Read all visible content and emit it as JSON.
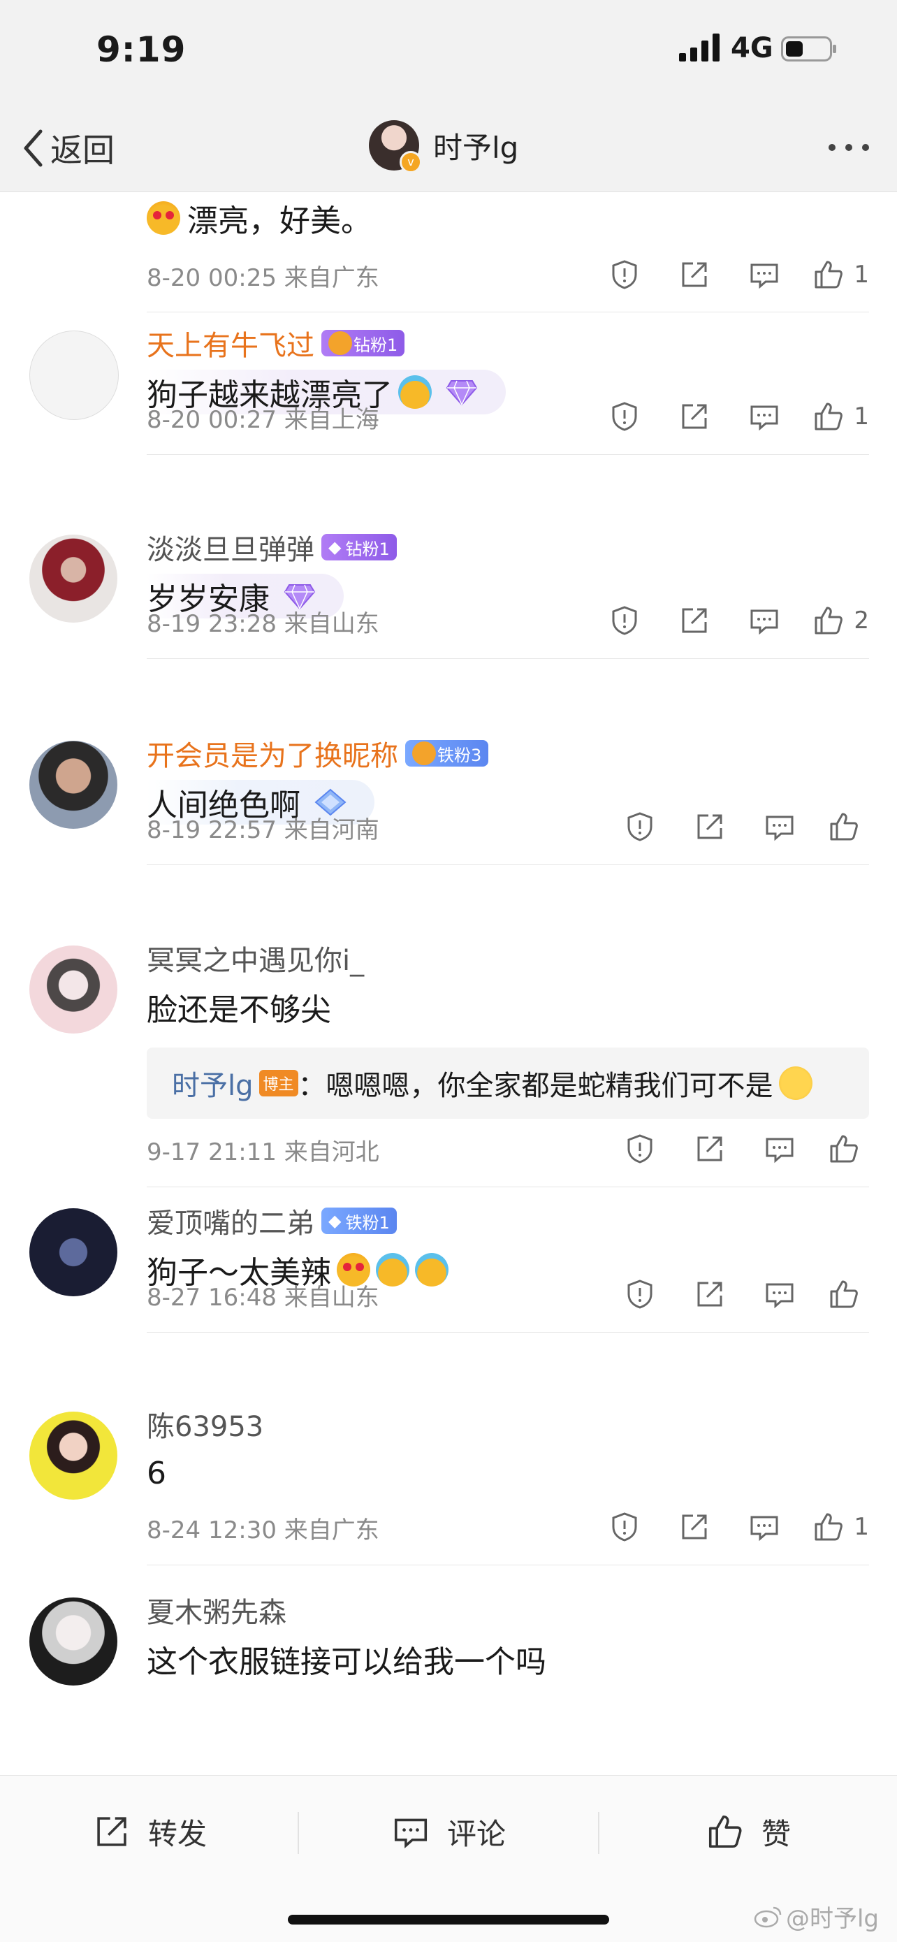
{
  "status": {
    "time": "9:19",
    "network": "4G"
  },
  "nav": {
    "back_label": "返回",
    "title": "时予lg"
  },
  "comments": [
    {
      "name": "",
      "text": "漂亮，好美。",
      "meta": "8-20 00:25 来自广东",
      "likes": "1"
    },
    {
      "name": "天上有牛飞过",
      "badge": "钻粉1",
      "text": "狗子越来越漂亮了",
      "meta": "8-20 00:27 来自上海",
      "likes": "1"
    },
    {
      "name": "淡淡旦旦弹弹",
      "badge": "钻粉1",
      "text": "岁岁安康",
      "meta": "8-19 23:28 来自山东",
      "likes": "2"
    },
    {
      "name": "开会员是为了换昵称",
      "badge": "铁粉3",
      "text": "人间绝色啊",
      "meta": "8-19 22:57 来自河南",
      "likes": ""
    },
    {
      "name": "冥冥之中遇见你i_",
      "text": "脸还是不够尖",
      "reply": {
        "name": "时予lg",
        "tag": "博主",
        "text": "：嗯嗯嗯，你全家都是蛇精我们可不是"
      },
      "meta": "9-17 21:11 来自河北",
      "likes": ""
    },
    {
      "name": "爱顶嘴的二弟",
      "badge": "铁粉1",
      "text": "狗子～太美辣",
      "meta": "8-27 16:48 来自山东",
      "likes": ""
    },
    {
      "name": "陈63953",
      "text": "6",
      "meta": "8-24 12:30 来自广东",
      "likes": "1"
    },
    {
      "name": "夏木粥先森",
      "text": "这个衣服链接可以给我一个吗",
      "meta": "",
      "likes": ""
    }
  ],
  "toolbar": {
    "repost": "转发",
    "comment": "评论",
    "like": "赞"
  },
  "watermark": "@时予lg",
  "colors": {
    "orange_name": "#e8731c",
    "link_blue": "#4a6fa5",
    "diamond_purple": "#9b6cf0",
    "iron_blue": "#6b96f5"
  },
  "icons": [
    "report-icon",
    "share-icon",
    "reply-icon",
    "like-icon"
  ]
}
